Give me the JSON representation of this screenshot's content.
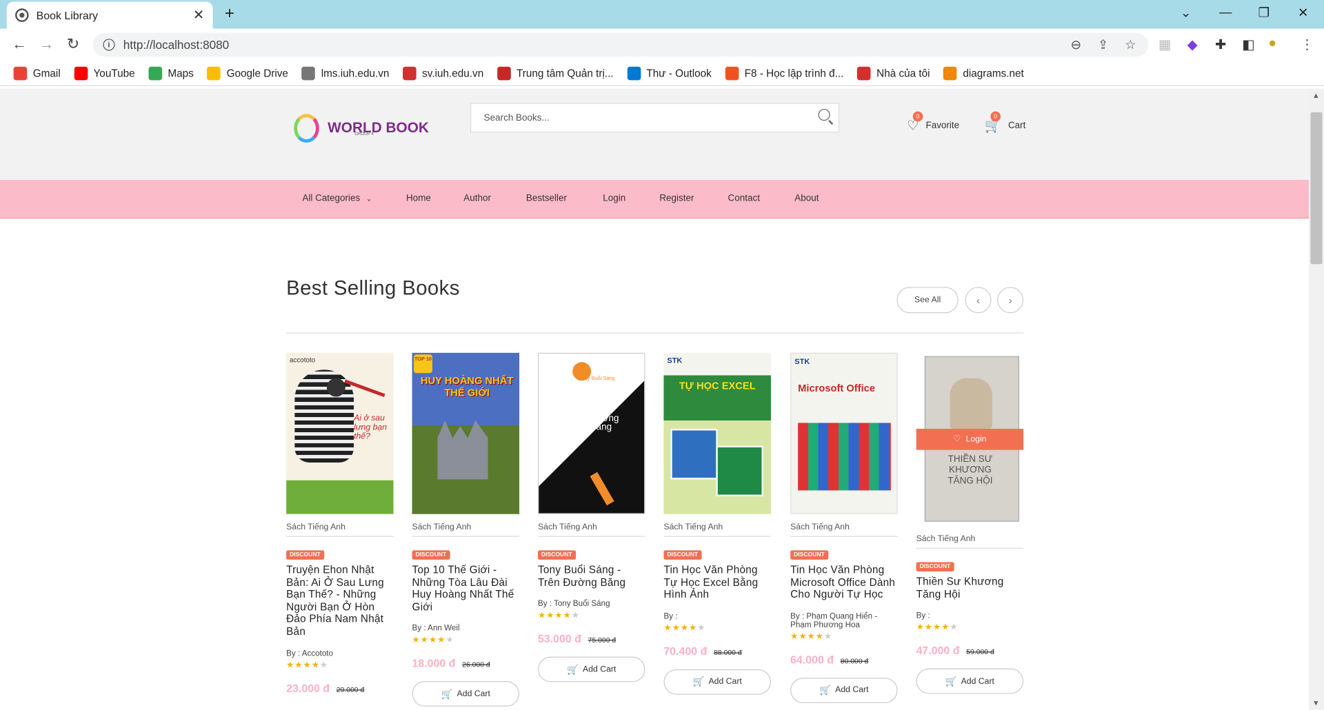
{
  "browser": {
    "tab_title": "Book Library",
    "url": "http://localhost:8080",
    "bookmarks": [
      {
        "label": "Gmail",
        "color": "#ea4335",
        "icon": "gmail-icon"
      },
      {
        "label": "YouTube",
        "color": "#ff0000",
        "icon": "youtube-icon"
      },
      {
        "label": "Maps",
        "color": "#34a853",
        "icon": "maps-icon"
      },
      {
        "label": "Google Drive",
        "color": "#fbbc04",
        "icon": "drive-icon"
      },
      {
        "label": "lms.iuh.edu.vn",
        "color": "#777777",
        "icon": "lms-icon"
      },
      {
        "label": "sv.iuh.edu.vn",
        "color": "#d32f2f",
        "icon": "iuh-icon"
      },
      {
        "label": "Trung tâm Quản trị...",
        "color": "#c62828",
        "icon": "center-icon"
      },
      {
        "label": "Thư - Outlook",
        "color": "#0078d4",
        "icon": "outlook-icon"
      },
      {
        "label": "F8 - Học lập trình đ...",
        "color": "#f05123",
        "icon": "f8-icon"
      },
      {
        "label": "Nhà của tôi",
        "color": "#d32f2f",
        "icon": "home-iuh-icon"
      },
      {
        "label": "diagrams.net",
        "color": "#f08705",
        "icon": "diagrams-icon"
      }
    ]
  },
  "header": {
    "logo_text": "WORLD BOOK",
    "logo_sub": "GROUP 4",
    "search_placeholder": "Search Books...",
    "favorite_label": "Favorite",
    "favorite_count": "0",
    "cart_label": "Cart",
    "cart_count": "0"
  },
  "menu": {
    "items": [
      "All Categories",
      "Home",
      "Author",
      "Bestseller",
      "Login",
      "Register",
      "Contact",
      "About"
    ]
  },
  "section": {
    "title": "Best Selling Books",
    "see_all": "See All"
  },
  "books": [
    {
      "category": "Sách Tiếng Anh",
      "discount": "DISCOUNT",
      "title": "Truyện Ehon Nhật Bản: Ai Ở Sau Lưng Bạn Thế? - Những Người Bạn Ở Hòn Đảo Phía Nam Nhật Bản",
      "author": "By : Accototo",
      "rating": 4,
      "price": "23.000 đ",
      "old_price": "29.000 đ",
      "add_cart": "Add Cart",
      "cover_bg": "#f7f1e4"
    },
    {
      "category": "Sách Tiếng Anh",
      "discount": "DISCOUNT",
      "title": "Top 10 Thế Giới - Những Tòa Lâu Đài Huy Hoàng Nhất Thế Giới",
      "author": "By : Ann Weil",
      "rating": 4,
      "price": "18.000 đ",
      "old_price": "26.000 đ",
      "add_cart": "Add Cart",
      "cover_bg": "#3a5aa8"
    },
    {
      "category": "Sách Tiếng Anh",
      "discount": "DISCOUNT",
      "title": "Tony Buổi Sáng - Trên Đường Băng",
      "author": "By : Tony Buổi Sáng",
      "rating": 4,
      "price": "53.000 đ",
      "old_price": "75.000 đ",
      "add_cart": "Add Cart",
      "cover_bg": "#111111"
    },
    {
      "category": "Sách Tiếng Anh",
      "discount": "DISCOUNT",
      "title": "Tin Học Văn Phòng Tự Học Excel Bằng Hình Ảnh",
      "author": "By :",
      "rating": 4,
      "price": "70.400 đ",
      "old_price": "88.000 đ",
      "add_cart": "Add Cart",
      "cover_bg": "#2e8a3c"
    },
    {
      "category": "Sách Tiếng Anh",
      "discount": "DISCOUNT",
      "title": "Tin Học Văn Phòng Microsoft Office Dành Cho Người Tự Học",
      "author": "By : Phạm Quang Hiển - Phạm Phương Hoa",
      "rating": 4,
      "price": "64.000 đ",
      "old_price": "80.000 đ",
      "add_cart": "Add Cart",
      "cover_bg": "#f4f4ee"
    },
    {
      "category": "Sách Tiếng Anh",
      "discount": "DISCOUNT",
      "title": "Thiền Sư Khương Tăng Hội",
      "author": "By :",
      "rating": 4,
      "price": "47.000 đ",
      "old_price": "59.000 đ",
      "add_cart": "Add Cart",
      "login_overlay": "Login",
      "cover_bg": "#cfcfcf"
    }
  ],
  "cover_texts": {
    "b1_brand": "accototo",
    "b1_title": "Ai ở sau lưng bạn thế?",
    "b2_badge": "TOP 10",
    "b2_title": "HUY HOÀNG NHẤT THẾ GIỚI",
    "b3_author": "Tony Buổi Sáng",
    "b3_title": "trên đường băng",
    "b4_brand": "STK",
    "b4_title": "TỰ HỌC EXCEL",
    "b5_brand": "STK",
    "b5_title": "Microsoft Office",
    "b6_title": "THIỀN SƯ KHƯƠNG TĂNG HỘI"
  }
}
